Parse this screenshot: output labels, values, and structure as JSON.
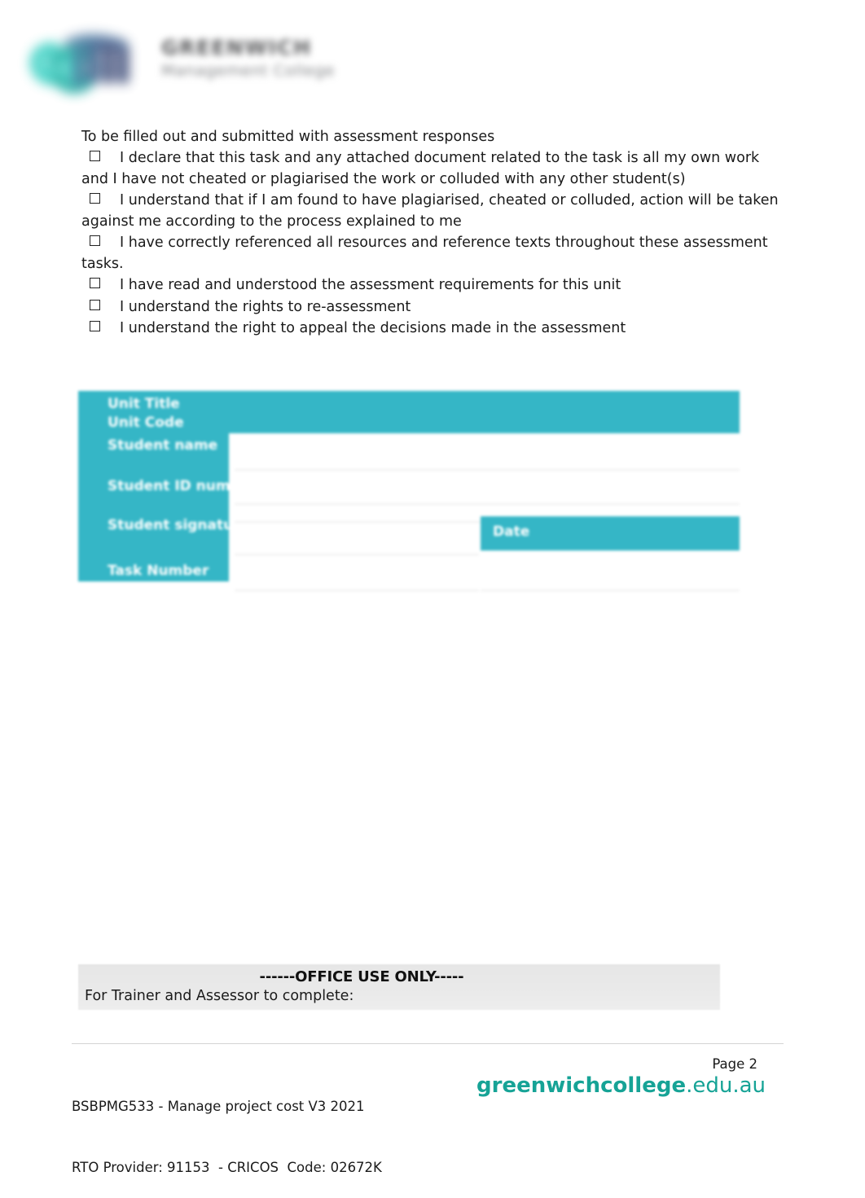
{
  "logo": {
    "mark_name": "greenwich-gm-swoosh-logo",
    "wordmark_line1": "GREENWICH",
    "wordmark_line2": "Management College",
    "mark_color_teal": "#2bbcae",
    "mark_color_navy": "#3c5080"
  },
  "declaration": {
    "intro": "To be filled out and submitted with assessment responses",
    "items": [
      "I declare that this task and any attached document related to the task is all my own work and I have not cheated or plagiarised the work or colluded with any other student(s)",
      "I understand that if I am found to have plagiarised, cheated or colluded, action will be taken against me according to the process explained to me",
      "I have correctly referenced all resources and reference texts throughout these assessment tasks.",
      "I have read and understood the assessment requirements for this unit",
      "I understand the rights to re-assessment",
      "I understand the right to appeal the decisions made in the assessment"
    ]
  },
  "details_table": {
    "header_color": "#35b6c6",
    "rows": [
      {
        "label": "Unit Title",
        "value": ""
      },
      {
        "label": "Unit Code",
        "value": ""
      },
      {
        "label": "Student name",
        "value": ""
      },
      {
        "label": "Student ID number",
        "value": ""
      },
      {
        "label": "Student signature",
        "value": ""
      },
      {
        "label": "Task Number",
        "value": ""
      }
    ],
    "date_label": "Date",
    "date_value": ""
  },
  "office_use": {
    "title": "------OFFICE USE ONLY-----",
    "subtitle": "For Trainer and Assessor to complete:"
  },
  "footer": {
    "unit_line": "BSBPMG533 - Manage project cost V3 2021",
    "rto_line": "RTO Provider: 91153  - CRICOS  Code: 02672K",
    "page": "Page 2",
    "url_bold": "greenwichcollege",
    "url_light": ".edu.au",
    "url_color": "#16a396"
  }
}
